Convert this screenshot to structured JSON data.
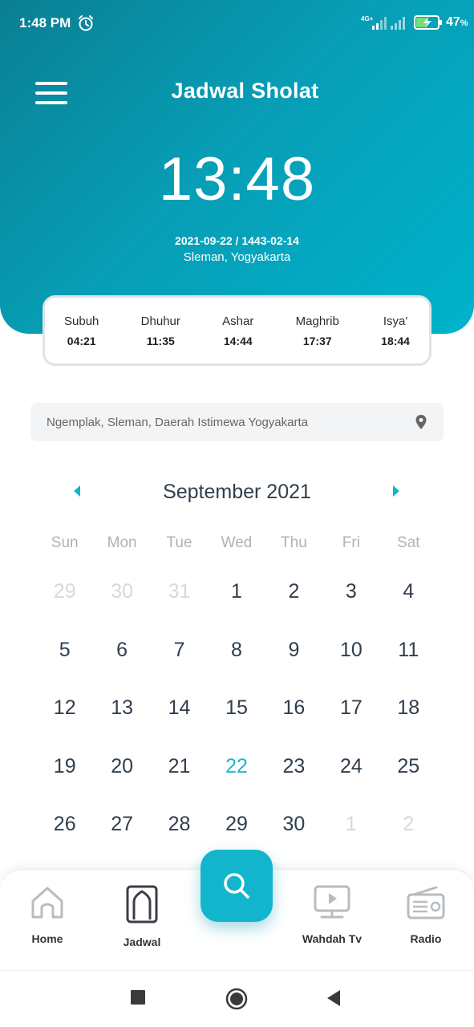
{
  "status_bar": {
    "time": "1:48 PM",
    "network": "4G+",
    "battery_percent": "47",
    "battery_unit": "%"
  },
  "header": {
    "title": "Jadwal Sholat",
    "clock": "13:48",
    "date": "2021-09-22 / 1443-02-14",
    "location": "Sleman, Yogyakarta"
  },
  "prayers": [
    {
      "name": "Subuh",
      "time": "04:21"
    },
    {
      "name": "Dhuhur",
      "time": "11:35"
    },
    {
      "name": "Ashar",
      "time": "14:44"
    },
    {
      "name": "Maghrib",
      "time": "17:37"
    },
    {
      "name": "Isya'",
      "time": "18:44"
    }
  ],
  "location_search": {
    "value": "Ngemplak, Sleman, Daerah Istimewa Yogyakarta"
  },
  "calendar": {
    "month_label": "September 2021",
    "weekdays": [
      "Sun",
      "Mon",
      "Tue",
      "Wed",
      "Thu",
      "Fri",
      "Sat"
    ],
    "days": [
      {
        "d": "29",
        "muted": true
      },
      {
        "d": "30",
        "muted": true
      },
      {
        "d": "31",
        "muted": true
      },
      {
        "d": "1"
      },
      {
        "d": "2"
      },
      {
        "d": "3"
      },
      {
        "d": "4"
      },
      {
        "d": "5"
      },
      {
        "d": "6"
      },
      {
        "d": "7"
      },
      {
        "d": "8"
      },
      {
        "d": "9"
      },
      {
        "d": "10"
      },
      {
        "d": "11"
      },
      {
        "d": "12"
      },
      {
        "d": "13"
      },
      {
        "d": "14"
      },
      {
        "d": "15"
      },
      {
        "d": "16"
      },
      {
        "d": "17"
      },
      {
        "d": "18"
      },
      {
        "d": "19"
      },
      {
        "d": "20"
      },
      {
        "d": "21"
      },
      {
        "d": "22",
        "today": true
      },
      {
        "d": "23"
      },
      {
        "d": "24"
      },
      {
        "d": "25"
      },
      {
        "d": "26"
      },
      {
        "d": "27"
      },
      {
        "d": "28"
      },
      {
        "d": "29"
      },
      {
        "d": "30"
      },
      {
        "d": "1",
        "muted": true
      },
      {
        "d": "2",
        "muted": true
      }
    ]
  },
  "bottom_nav": {
    "home": "Home",
    "jadwal": "Jadwal",
    "wahdah_tv": "Wahdah Tv",
    "radio": "Radio"
  },
  "colors": {
    "accent": "#13b5cc",
    "header_start": "#0a7f93",
    "header_end": "#00b3cc",
    "today": "#1ab6cf"
  }
}
